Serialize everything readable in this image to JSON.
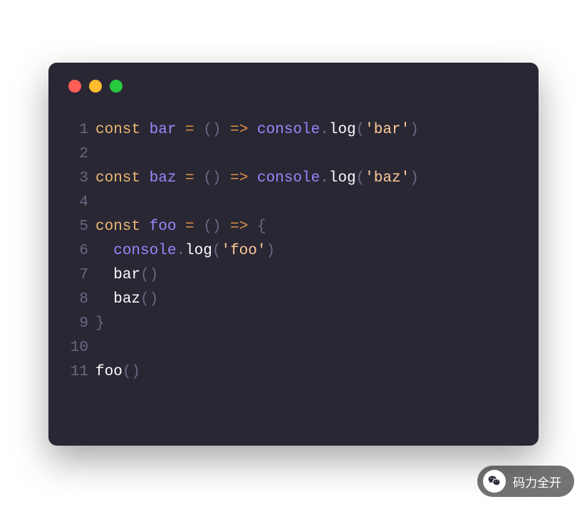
{
  "editor": {
    "lines": [
      {
        "num": "1",
        "tokens": [
          {
            "t": "const ",
            "c": "keyword"
          },
          {
            "t": "bar",
            "c": "ident"
          },
          {
            "t": " ",
            "c": "plain"
          },
          {
            "t": "=",
            "c": "op"
          },
          {
            "t": " ",
            "c": "plain"
          },
          {
            "t": "(",
            "c": "paren"
          },
          {
            "t": ")",
            "c": "paren"
          },
          {
            "t": " ",
            "c": "plain"
          },
          {
            "t": "=>",
            "c": "op"
          },
          {
            "t": " ",
            "c": "plain"
          },
          {
            "t": "console",
            "c": "ident"
          },
          {
            "t": ".",
            "c": "dot"
          },
          {
            "t": "log",
            "c": "call"
          },
          {
            "t": "(",
            "c": "paren"
          },
          {
            "t": "'bar'",
            "c": "string"
          },
          {
            "t": ")",
            "c": "paren"
          }
        ]
      },
      {
        "num": "2",
        "tokens": []
      },
      {
        "num": "3",
        "tokens": [
          {
            "t": "const ",
            "c": "keyword"
          },
          {
            "t": "baz",
            "c": "ident"
          },
          {
            "t": " ",
            "c": "plain"
          },
          {
            "t": "=",
            "c": "op"
          },
          {
            "t": " ",
            "c": "plain"
          },
          {
            "t": "(",
            "c": "paren"
          },
          {
            "t": ")",
            "c": "paren"
          },
          {
            "t": " ",
            "c": "plain"
          },
          {
            "t": "=>",
            "c": "op"
          },
          {
            "t": " ",
            "c": "plain"
          },
          {
            "t": "console",
            "c": "ident"
          },
          {
            "t": ".",
            "c": "dot"
          },
          {
            "t": "log",
            "c": "call"
          },
          {
            "t": "(",
            "c": "paren"
          },
          {
            "t": "'baz'",
            "c": "string"
          },
          {
            "t": ")",
            "c": "paren"
          }
        ]
      },
      {
        "num": "4",
        "tokens": []
      },
      {
        "num": "5",
        "tokens": [
          {
            "t": "const ",
            "c": "keyword"
          },
          {
            "t": "foo",
            "c": "ident"
          },
          {
            "t": " ",
            "c": "plain"
          },
          {
            "t": "=",
            "c": "op"
          },
          {
            "t": " ",
            "c": "plain"
          },
          {
            "t": "(",
            "c": "paren"
          },
          {
            "t": ")",
            "c": "paren"
          },
          {
            "t": " ",
            "c": "plain"
          },
          {
            "t": "=>",
            "c": "op"
          },
          {
            "t": " ",
            "c": "plain"
          },
          {
            "t": "{",
            "c": "brace"
          }
        ]
      },
      {
        "num": "6",
        "tokens": [
          {
            "t": "  ",
            "c": "plain"
          },
          {
            "t": "console",
            "c": "ident"
          },
          {
            "t": ".",
            "c": "dot"
          },
          {
            "t": "log",
            "c": "call"
          },
          {
            "t": "(",
            "c": "paren"
          },
          {
            "t": "'foo'",
            "c": "string"
          },
          {
            "t": ")",
            "c": "paren"
          }
        ]
      },
      {
        "num": "7",
        "tokens": [
          {
            "t": "  ",
            "c": "plain"
          },
          {
            "t": "bar",
            "c": "call"
          },
          {
            "t": "(",
            "c": "paren"
          },
          {
            "t": ")",
            "c": "paren"
          }
        ]
      },
      {
        "num": "8",
        "tokens": [
          {
            "t": "  ",
            "c": "plain"
          },
          {
            "t": "baz",
            "c": "call"
          },
          {
            "t": "(",
            "c": "paren"
          },
          {
            "t": ")",
            "c": "paren"
          }
        ]
      },
      {
        "num": "9",
        "tokens": [
          {
            "t": "}",
            "c": "brace"
          }
        ]
      },
      {
        "num": "10",
        "tokens": []
      },
      {
        "num": "11",
        "tokens": [
          {
            "t": "foo",
            "c": "call"
          },
          {
            "t": "(",
            "c": "paren"
          },
          {
            "t": ")",
            "c": "paren"
          }
        ]
      }
    ]
  },
  "footer": {
    "label": "码力全开",
    "icon_name": "wechat-icon"
  }
}
